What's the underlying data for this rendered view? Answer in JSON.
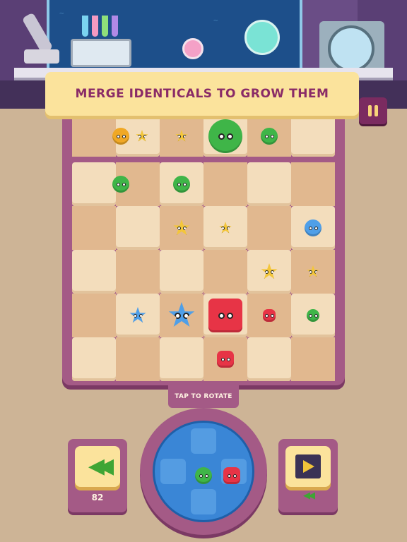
{
  "banner": {
    "text": "MERGE IDENTICALS TO GROW THEM"
  },
  "controls": {
    "rotate_label": "TAP TO ROTATE",
    "undo_count": "82",
    "undo_icon": "rewind-icon",
    "video_icon": "film-play-icon",
    "video_sub_icon": "rewind-small-icon"
  },
  "colors": {
    "board": "#a45a86",
    "banner_bg": "#fbe39c",
    "banner_text": "#8a2b67",
    "yellow": "#f3c63a",
    "orange": "#f0a825",
    "green": "#3fb548",
    "blue": "#4f9fe8",
    "red": "#e73446"
  },
  "board": {
    "rows": 6,
    "cols": 6,
    "pieces": [
      {
        "row": 0,
        "col": 1,
        "color": "orange",
        "shape": "round",
        "size": "small",
        "state": "merging"
      },
      {
        "row": 0,
        "col": 1,
        "color": "yellow",
        "shape": "star",
        "size": "tiny"
      },
      {
        "row": 0,
        "col": 2,
        "color": "yellow",
        "shape": "star",
        "size": "tiny"
      },
      {
        "row": 0,
        "col": 3,
        "color": "green",
        "shape": "round",
        "size": "large"
      },
      {
        "row": 0,
        "col": 4,
        "color": "green",
        "shape": "round",
        "size": "small"
      },
      {
        "row": 1,
        "col": 1,
        "color": "green",
        "shape": "round",
        "size": "small",
        "state": "merging"
      },
      {
        "row": 1,
        "col": 2,
        "color": "green",
        "shape": "round",
        "size": "small"
      },
      {
        "row": 2,
        "col": 2,
        "color": "yellow",
        "shape": "star",
        "size": "small"
      },
      {
        "row": 2,
        "col": 3,
        "color": "yellow",
        "shape": "star",
        "size": "tiny"
      },
      {
        "row": 2,
        "col": 5,
        "color": "blue",
        "shape": "round",
        "size": "small"
      },
      {
        "row": 3,
        "col": 4,
        "color": "yellow",
        "shape": "star",
        "size": "small"
      },
      {
        "row": 3,
        "col": 5,
        "color": "yellow",
        "shape": "star",
        "size": "tiny"
      },
      {
        "row": 4,
        "col": 1,
        "color": "blue",
        "shape": "star",
        "size": "small"
      },
      {
        "row": 4,
        "col": 2,
        "color": "blue",
        "shape": "star",
        "size": "medium"
      },
      {
        "row": 4,
        "col": 3,
        "color": "red",
        "shape": "square",
        "size": "large"
      },
      {
        "row": 4,
        "col": 4,
        "color": "red",
        "shape": "square",
        "size": "tiny"
      },
      {
        "row": 4,
        "col": 5,
        "color": "green",
        "shape": "round",
        "size": "tiny"
      },
      {
        "row": 5,
        "col": 3,
        "color": "red",
        "shape": "square",
        "size": "small"
      }
    ]
  },
  "next_piece": [
    {
      "color": "green",
      "shape": "round",
      "size": "small"
    },
    {
      "color": "red",
      "shape": "square",
      "size": "small"
    }
  ]
}
